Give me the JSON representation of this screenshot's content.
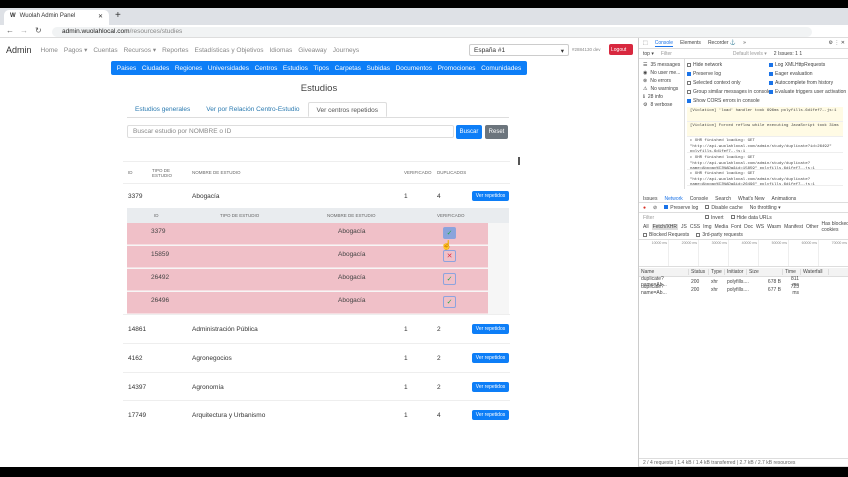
{
  "browser": {
    "tab_title": "Wuolah Admin Panel",
    "url_host": "admin.wuolahlocal.com",
    "url_path": "/resources/studies"
  },
  "navbar": {
    "brand": "Admin",
    "items": [
      "Home",
      "Pagos ▾",
      "Cuentas",
      "Recursos ▾",
      "Reportes",
      "Estadísticas y Objetivos",
      "Idiomas",
      "Giveaway",
      "Journeys"
    ],
    "country": "España #1",
    "user": "#2884130 dev",
    "logout": "Logout"
  },
  "pills": [
    "Paises",
    "Ciudades",
    "Regiones",
    "Universidades",
    "Centros",
    "Estudios",
    "Tipos",
    "Carpetas",
    "Subidas",
    "Documentos",
    "Promociones",
    "Comunidades"
  ],
  "title": "Estudios",
  "tabs": [
    {
      "label": "Estudios generales"
    },
    {
      "label": "Ver por Relación Centro-Estudio"
    },
    {
      "label": "Ver centros repetidos",
      "active": true
    }
  ],
  "search": {
    "placeholder": "Buscar estudio por NOMBRE o ID",
    "buscar": "Buscar",
    "reset": "Reset"
  },
  "table": {
    "headers": [
      "ID",
      "TIPO DE ESTUDIO",
      "NOMBRE DE ESTUDIO",
      "VERIFICADO",
      "DUPLICADOS"
    ],
    "button": "Ver repetidos",
    "rows": [
      {
        "id": "3379",
        "name": "Abogacía",
        "verificado": "1",
        "duplicados": "4"
      },
      {
        "id": "14861",
        "name": "Administración Pública",
        "verificado": "1",
        "duplicados": "2"
      },
      {
        "id": "4162",
        "name": "Agronegocios",
        "verificado": "1",
        "duplicados": "2"
      },
      {
        "id": "14397",
        "name": "Agronomía",
        "verificado": "1",
        "duplicados": "2"
      },
      {
        "id": "17749",
        "name": "Arquitectura y Urbanismo",
        "verificado": "1",
        "duplicados": "4"
      }
    ]
  },
  "subtable": {
    "headers": [
      "ID",
      "TIPO DE ESTUDIO",
      "NOMBRE DE ESTUDIO",
      "VERIFICADO"
    ],
    "rows": [
      {
        "id": "3379",
        "name": "Abogacía",
        "verified": true
      },
      {
        "id": "15859",
        "name": "Abogacía",
        "verified": false
      },
      {
        "id": "26492",
        "name": "Abogacía",
        "verified": true
      },
      {
        "id": "26496",
        "name": "Abogacía",
        "verified": true
      }
    ]
  },
  "devtools": {
    "tabs": [
      "Console",
      "Elements",
      "Recorder ⚓",
      "»"
    ],
    "context": "top ▾",
    "filter": "Filter",
    "levels": "Default levels ▾",
    "issues": "2 Issues: 1  1",
    "sidebar": [
      "35 messages",
      "No user me...",
      "No errors",
      "No warnings",
      "28 info",
      "8 verbose"
    ],
    "settings_left": [
      {
        "l": "Hide network",
        "on": false
      },
      {
        "l": "Preserve log",
        "on": true
      },
      {
        "l": "Selected context only",
        "on": false
      },
      {
        "l": "Group similar messages in console",
        "on": false
      },
      {
        "l": "Show CORS errors in console",
        "on": true
      }
    ],
    "settings_right": [
      {
        "l": "Log XMLHttpRequests",
        "on": true
      },
      {
        "l": "Eager evaluation",
        "on": true
      },
      {
        "l": "Autocomplete from history",
        "on": true
      },
      {
        "l": "Evaluate triggers user activation",
        "on": true
      }
    ],
    "logs": [
      "[Violation] 'load' handler took 696ms   polyfills.6d1fef7….js:1",
      "[Violation] Forced reflow while executing JavaScript took 31ms",
      "▸ XHR finished loading: GET \"http://api.wuolahlocal.com/admin/study/duplicate?id=26492\"  polyfills.6d1fef7….js:1",
      "▸ XHR finished loading: GET \"http://api.wuolahlocal.com/admin/study/duplicate?name=Abogac%C3%ADa&id=15859\"  polyfills.6d1fef7….js:1",
      "▸ XHR finished loading: GET \"http://api.wuolahlocal.com/admin/study/duplicate?name=Abogac%C3%ADa&id=26496\"  polyfills.6d1fef7….js:1"
    ],
    "drawer_tabs": [
      "Issues",
      "Network",
      "Console",
      "Search",
      "What's New",
      "Animations"
    ],
    "net_toolbar": {
      "preserve": "Preserve log",
      "cache": "Disable cache",
      "throttle": "No throttling ▾"
    },
    "net_filter": {
      "filter": "Filter",
      "invert": "Invert",
      "hide": "Hide data URLs",
      "types": [
        "All",
        "Fetch/XHR",
        "JS",
        "CSS",
        "Img",
        "Media",
        "Font",
        "Doc",
        "WS",
        "Wasm",
        "Manifest",
        "Other"
      ],
      "blocked_cookies": "Has blocked cookies",
      "blocked_req": "Blocked Requests",
      "third": "3rd-party requests"
    },
    "timeline": [
      "10000 ms",
      "20000 ms",
      "30000 ms",
      "40000 ms",
      "50000 ms",
      "60000 ms",
      "70000 ms"
    ],
    "net_headers": [
      "Name",
      "Status",
      "Type",
      "Initiator",
      "Size",
      "Time",
      "Waterfall"
    ],
    "net_rows": [
      {
        "name": "duplicate?name=Ab...",
        "status": "200",
        "type": "xhr",
        "init": "polyfills....",
        "size": "678 B",
        "time": "811 ms"
      },
      {
        "name": "duplicate?name=Ab...",
        "status": "200",
        "type": "xhr",
        "init": "polyfills....",
        "size": "677 B",
        "time": "723 ms"
      }
    ],
    "status": "2 / 4 requests  |  1.4 kB / 1.4 kB transferred  |  2.7 kB / 2.7 kB resources"
  }
}
